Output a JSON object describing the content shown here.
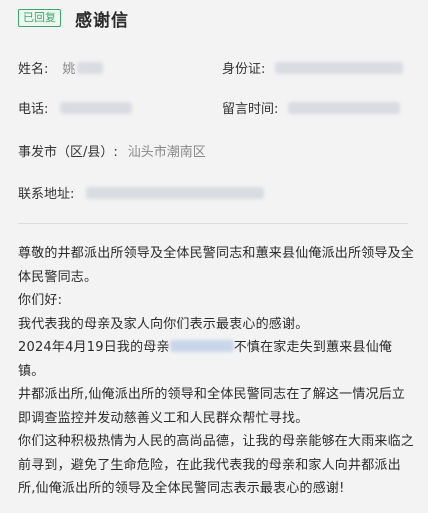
{
  "header": {
    "badge": "已回复",
    "title": "感谢信"
  },
  "fields": {
    "name_label": "姓名:",
    "name_value": "姚",
    "id_label": "身份证:",
    "phone_label": "电话:",
    "time_label": "留言时间:",
    "location_label": "事发市（区/县）:",
    "location_value": "汕头市潮南区",
    "address_label": "联系地址:"
  },
  "content": {
    "para1": "尊敬的井都派出所领导及全体民警同志和蕙来县仙俺派出所领导及全体民警同志。",
    "para2": "你们好:",
    "para3": "我代表我的母亲及家人向你们表示最衷心的感谢。",
    "para4_prefix": "2024年4月19日我的母亲",
    "para4_suffix": "不慎在家走失到蕙来县仙俺镇。",
    "para5": "井都派出所,仙俺派出所的领导和全体民警同志在了解这一情况后立即调查监控并发动慈善义工和人民群众帮忙寻找。",
    "para6": "你们这种积极热情为人民的高尚品德，让我的母亲能够在大雨来临之前寻到，避免了生命危险，在此我代表我的母亲和家人向井都派出所,仙俺派出所的领导及全体民警同志表示最衷心的感谢!"
  }
}
